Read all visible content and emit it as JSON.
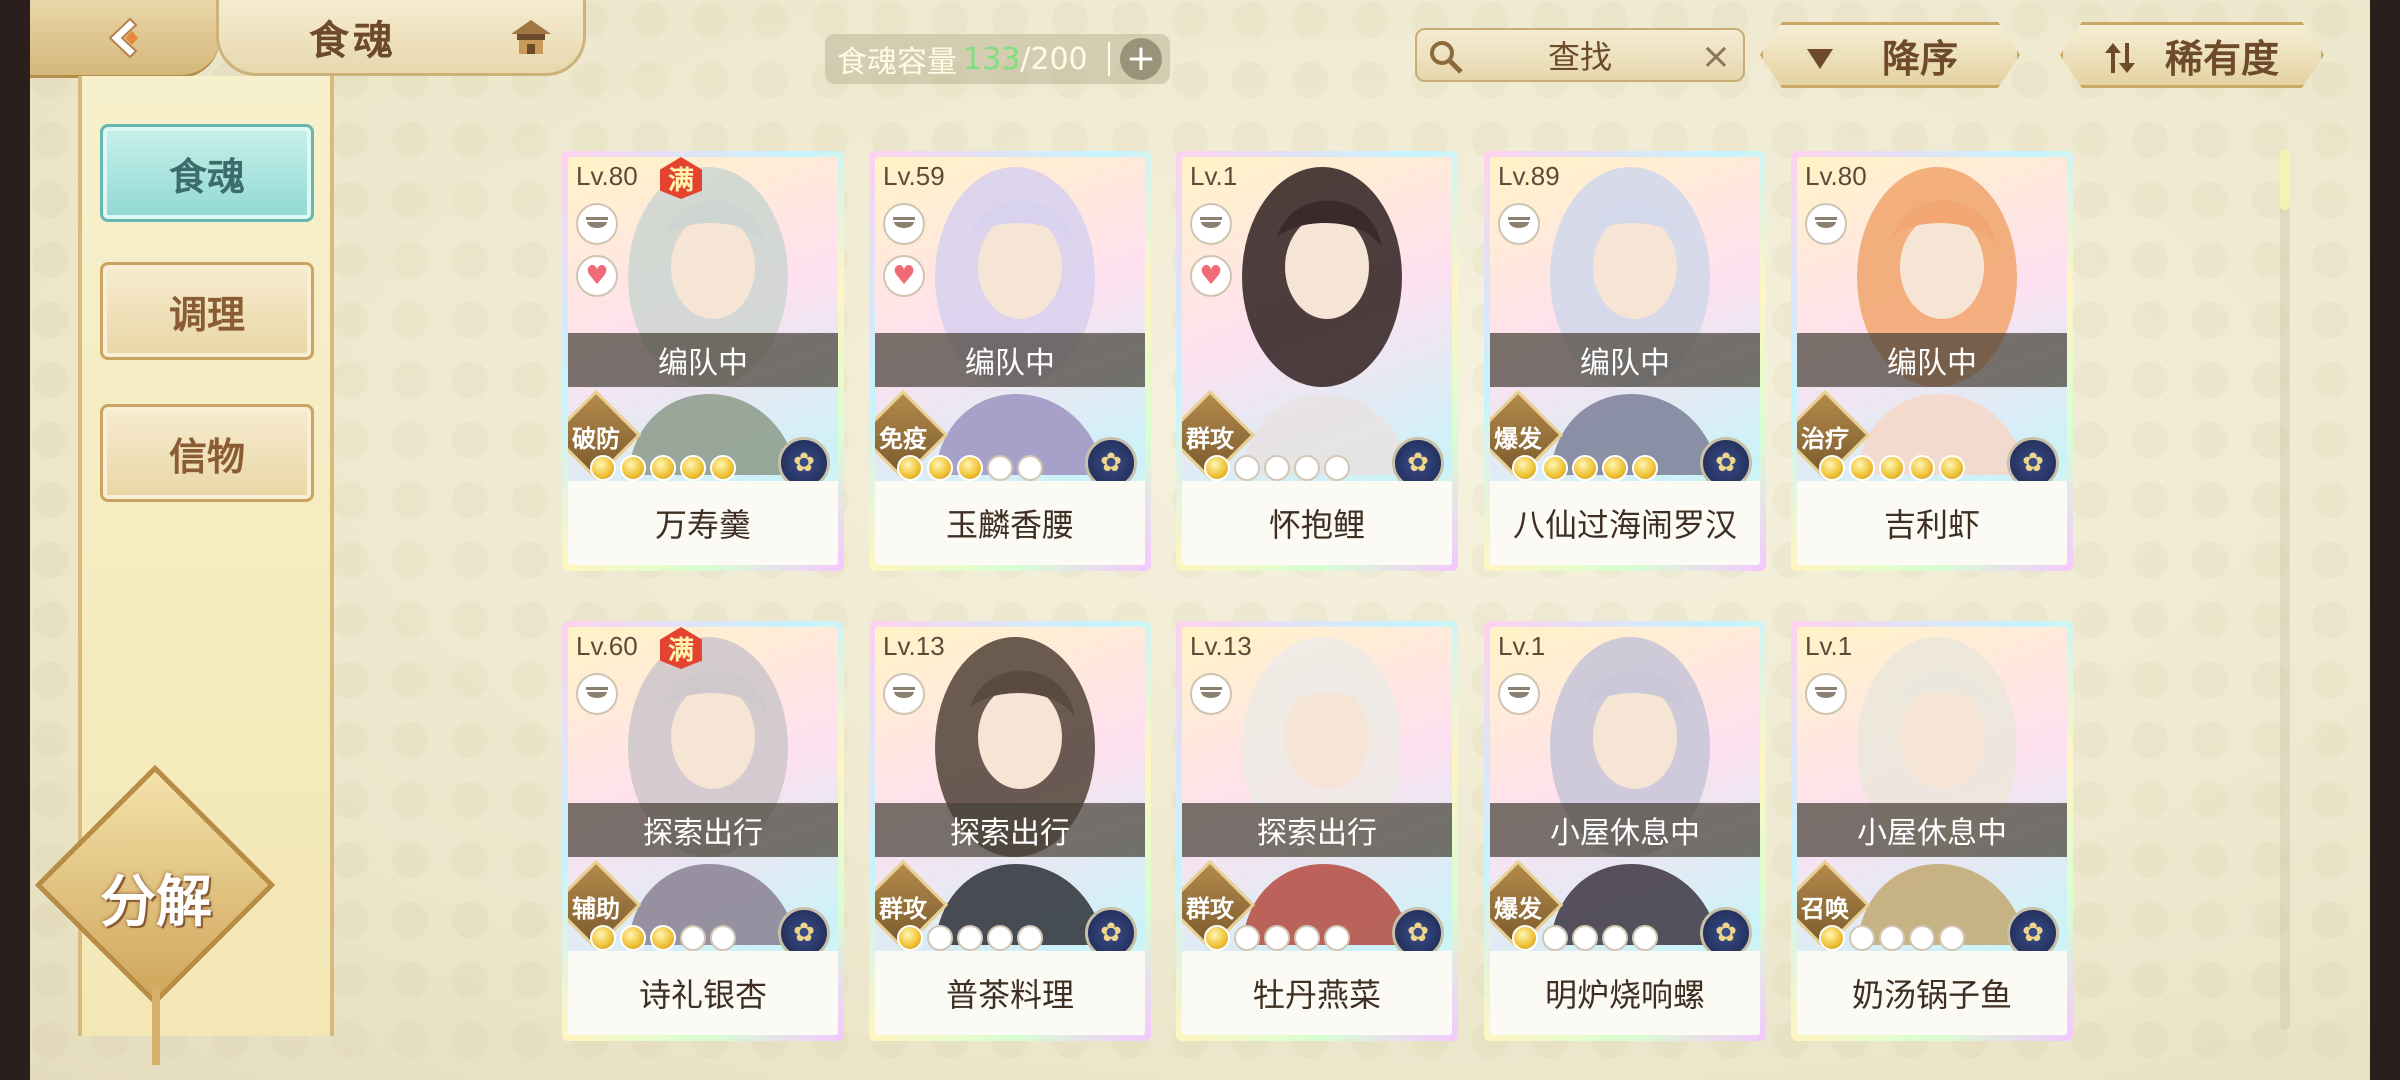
{
  "header": {
    "title": "食魂",
    "capacity_label": "食魂容量",
    "capacity_current": "133",
    "capacity_separator": "/",
    "capacity_max": "200",
    "add_label": "+",
    "search_placeholder": "查找",
    "clear_label": "×",
    "sort_order_label": "降序",
    "sort_field_label": "稀有度"
  },
  "sidebar": {
    "items": [
      {
        "label": "食魂",
        "active": true
      },
      {
        "label": "调理",
        "active": false
      },
      {
        "label": "信物",
        "active": false
      }
    ],
    "decompose_label": "分解"
  },
  "colors": {
    "accent_teal": "#8fd9d2",
    "gold": "#d6b06a",
    "capacity_green": "#7fe07f"
  },
  "cards": [
    {
      "level": "Lv.80",
      "full": "满",
      "status": "编队中",
      "role": "破防",
      "stars": 5,
      "name": "万寿羹",
      "heart": true,
      "element_icon": "lotus-icon"
    },
    {
      "level": "Lv.59",
      "full": "",
      "status": "编队中",
      "role": "免疫",
      "stars": 3,
      "name": "玉麟香腰",
      "heart": true,
      "element_icon": "flower-icon"
    },
    {
      "level": "Lv.1",
      "full": "",
      "status": "",
      "role": "群攻",
      "stars": 1,
      "name": "怀抱鲤",
      "heart": true,
      "element_icon": "flower-icon"
    },
    {
      "level": "Lv.89",
      "full": "",
      "status": "编队中",
      "role": "爆发",
      "stars": 5,
      "name": "八仙过海闹罗汉",
      "heart": false,
      "element_icon": "lotus-icon"
    },
    {
      "level": "Lv.80",
      "full": "",
      "status": "编队中",
      "role": "治疗",
      "stars": 5,
      "name": "吉利虾",
      "heart": false,
      "element_icon": "flower-icon"
    },
    {
      "level": "Lv.60",
      "full": "满",
      "status": "探索出行",
      "role": "辅助",
      "stars": 3,
      "name": "诗礼银杏",
      "heart": false,
      "element_icon": "flower-icon"
    },
    {
      "level": "Lv.13",
      "full": "",
      "status": "探索出行",
      "role": "群攻",
      "stars": 1,
      "name": "普茶料理",
      "heart": false,
      "element_icon": "flower-icon"
    },
    {
      "level": "Lv.13",
      "full": "",
      "status": "探索出行",
      "role": "群攻",
      "stars": 1,
      "name": "牡丹燕菜",
      "heart": false,
      "element_icon": "flower-icon"
    },
    {
      "level": "Lv.1",
      "full": "",
      "status": "小屋休息中",
      "role": "爆发",
      "stars": 1,
      "name": "明炉烧响螺",
      "heart": false,
      "element_icon": "flower-icon"
    },
    {
      "level": "Lv.1",
      "full": "",
      "status": "小屋休息中",
      "role": "召唤",
      "stars": 1,
      "name": "奶汤锅子鱼",
      "heart": false,
      "element_icon": "flower-icon"
    }
  ]
}
